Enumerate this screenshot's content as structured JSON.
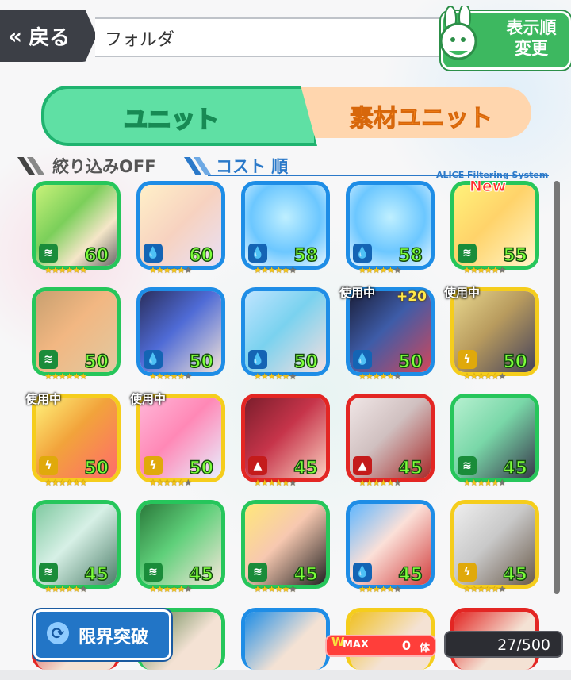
{
  "header": {
    "back_label": "戻る",
    "title": "フォルダ",
    "sort_button_label_1": "表示順",
    "sort_button_label_2": "変更"
  },
  "tabs": [
    {
      "label": "ユニット",
      "active": true
    },
    {
      "label": "素材ユニット",
      "active": false
    }
  ],
  "filter": {
    "narrow_label": "絞り込みOFF",
    "sort_label": "コスト 順",
    "system_label": "ALICE Filtering System"
  },
  "units": [
    {
      "color": "green",
      "element": "wind",
      "cost": "60",
      "stars": 6,
      "badge": ""
    },
    {
      "color": "blue",
      "element": "water",
      "cost": "60",
      "stars": 5,
      "badge": ""
    },
    {
      "color": "blue",
      "element": "water",
      "cost": "58",
      "stars": 5,
      "badge": ""
    },
    {
      "color": "blue",
      "element": "water",
      "cost": "58",
      "stars": 5,
      "badge": ""
    },
    {
      "color": "green",
      "element": "wind",
      "cost": "55",
      "stars": 5,
      "badge": "New"
    },
    {
      "color": "green",
      "element": "wind",
      "cost": "50",
      "stars": 6,
      "badge": ""
    },
    {
      "color": "blue",
      "element": "water",
      "cost": "50",
      "stars": 5,
      "badge": ""
    },
    {
      "color": "blue",
      "element": "water",
      "cost": "50",
      "stars": 5,
      "badge": ""
    },
    {
      "color": "blue",
      "element": "water",
      "cost": "50",
      "stars": 5,
      "badge": "使用中",
      "plus": "+20"
    },
    {
      "color": "yellow",
      "element": "thunder",
      "cost": "50",
      "stars": 5,
      "badge": "使用中"
    },
    {
      "color": "yellow",
      "element": "thunder",
      "cost": "50",
      "stars": 6,
      "badge": "使用中"
    },
    {
      "color": "yellow",
      "element": "thunder",
      "cost": "50",
      "stars": 5,
      "badge": "使用中"
    },
    {
      "color": "red",
      "element": "fire",
      "cost": "45",
      "stars": 5,
      "badge": ""
    },
    {
      "color": "red",
      "element": "fire",
      "cost": "45",
      "stars": 5,
      "badge": ""
    },
    {
      "color": "green",
      "element": "wind",
      "cost": "45",
      "stars": 5,
      "badge": ""
    },
    {
      "color": "green",
      "element": "wind",
      "cost": "45",
      "stars": 5,
      "badge": ""
    },
    {
      "color": "green",
      "element": "wind",
      "cost": "45",
      "stars": 5,
      "badge": ""
    },
    {
      "color": "green",
      "element": "wind",
      "cost": "45",
      "stars": 5,
      "badge": ""
    },
    {
      "color": "blue",
      "element": "water",
      "cost": "45",
      "stars": 5,
      "badge": ""
    },
    {
      "color": "yellow",
      "element": "thunder",
      "cost": "45",
      "stars": 5,
      "badge": ""
    }
  ],
  "bottom": {
    "limit_break_label": "限界突破",
    "max_label": "MAX",
    "max_w": "W",
    "max_count": "0",
    "max_unit": "体",
    "owned_count": "27/500"
  },
  "colors": {
    "green": "#26c65b",
    "blue": "#1e8de6",
    "yellow": "#f5cd1c",
    "red": "#e32623",
    "tab_active": "#5fe0a4",
    "tab_inactive": "#ffd6ae",
    "accent_blue": "#2b79c9"
  },
  "icons": {
    "back": "chevron-double-left-icon",
    "sort": "rabbit-icon",
    "limit_break": "refresh-icon",
    "wind": "wind-element-icon",
    "water": "water-element-icon",
    "fire": "fire-element-icon",
    "thunder": "thunder-element-icon"
  }
}
